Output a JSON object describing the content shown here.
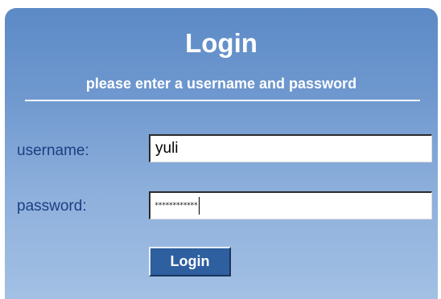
{
  "login_panel": {
    "title": "Login",
    "subtitle": "please enter a username and password",
    "username_label": "username:",
    "username_value": "yuli",
    "password_label": "password:",
    "password_masked": "************",
    "button_label": "Login"
  },
  "colors": {
    "panel_top": "#5c8ac6",
    "panel_bottom": "#a3c0e4",
    "label_text": "#1c3f82",
    "button_bg": "#2e5f9f",
    "title_text": "#ffffff"
  }
}
